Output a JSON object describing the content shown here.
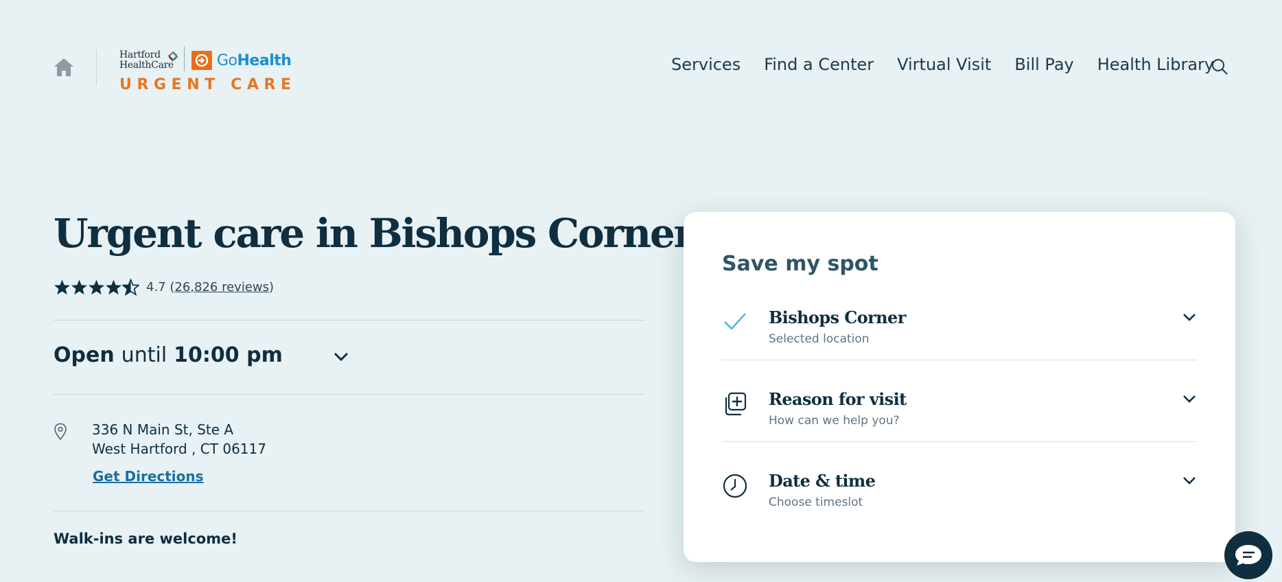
{
  "header": {
    "logo": {
      "hartford_line1": "Hartford",
      "hartford_line2": "HealthCare",
      "gohealth_go": "Go",
      "gohealth_health": "Health",
      "urgent_care": "URGENT CARE"
    },
    "nav": [
      "Services",
      "Find a Center",
      "Virtual Visit",
      "Bill Pay",
      "Health Library"
    ],
    "icons": {
      "home": "home-icon",
      "search": "search-icon"
    }
  },
  "main": {
    "title": "Urgent care in Bishops Corner",
    "rating": {
      "value": "4.7",
      "reviews": "26,826 reviews",
      "stars": 4.7
    },
    "hours": {
      "status": "Open",
      "until": "until",
      "time": "10:00 pm"
    },
    "address": {
      "line1": "336 N Main St, Ste A",
      "line2": "West Hartford , CT 06117"
    },
    "directions_label": "Get Directions",
    "walkins": "Walk-ins are welcome!"
  },
  "card": {
    "title": "Save my spot",
    "steps": [
      {
        "title": "Bishops Corner",
        "subtitle": "Selected location",
        "icon": "check-icon"
      },
      {
        "title": "Reason for visit",
        "subtitle": "How can we help you?",
        "icon": "medical-cards-icon"
      },
      {
        "title": "Date & time",
        "subtitle": "Choose timeslot",
        "icon": "clock-icon"
      }
    ]
  },
  "colors": {
    "background": "#e8f1f4",
    "primary_text": "#0f2e3f",
    "link": "#1a6da3",
    "brand_orange": "#e8761f",
    "brand_blue": "#1c8fd0",
    "check": "#3fb4e0"
  }
}
